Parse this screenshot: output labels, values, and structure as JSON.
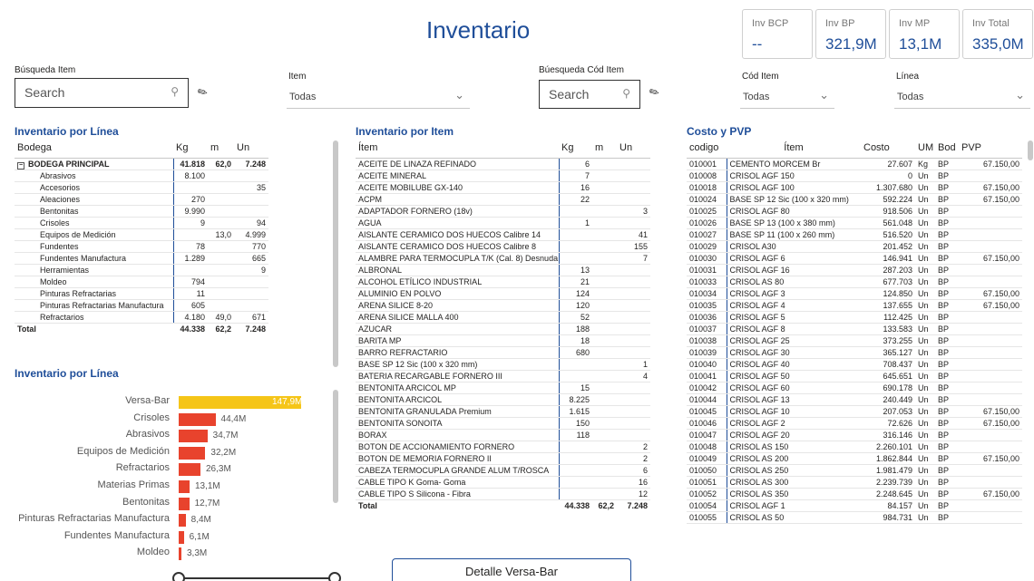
{
  "header": {
    "title": "Inventario"
  },
  "kpis": [
    {
      "label": "Inv BCP",
      "value": "--"
    },
    {
      "label": "Inv BP",
      "value": "321,9M"
    },
    {
      "label": "Inv MP",
      "value": "13,1M"
    },
    {
      "label": "Inv Total",
      "value": "335,0M"
    }
  ],
  "filters": {
    "busqueda_item": {
      "label": "Búsqueda Item",
      "placeholder": "Search"
    },
    "item": {
      "label": "Item",
      "value": "Todas"
    },
    "busqueda_cod_item": {
      "label": "Búesqueda Cód Item",
      "placeholder": "Search"
    },
    "cod_item": {
      "label": "Cód Item",
      "value": "Todas"
    },
    "linea": {
      "label": "Línea",
      "value": "Todas"
    }
  },
  "inv_linea_table": {
    "title": "Inventario por Línea",
    "columns": [
      "Bodega",
      "Kg",
      "m",
      "Un"
    ],
    "parent": {
      "name": "BODEGA PRINCIPAL",
      "kg": "41.818",
      "m": "62,0",
      "un": "7.248"
    },
    "rows": [
      [
        "Abrasivos",
        "8.100",
        "",
        ""
      ],
      [
        "Accesorios",
        "",
        "",
        "35"
      ],
      [
        "Aleaciones",
        "270",
        "",
        ""
      ],
      [
        "Bentonitas",
        "9.990",
        "",
        ""
      ],
      [
        "Crisoles",
        "9",
        "",
        "94"
      ],
      [
        "Equipos de Medición",
        "",
        "13,0",
        "4.999"
      ],
      [
        "Fundentes",
        "78",
        "",
        "770"
      ],
      [
        "Fundentes Manufactura",
        "1.289",
        "",
        "665"
      ],
      [
        "Herramientas",
        "",
        "",
        "9"
      ],
      [
        "Moldeo",
        "794",
        "",
        ""
      ],
      [
        "Pinturas Refractarias",
        "11",
        "",
        ""
      ],
      [
        "Pinturas Refractarias Manufactura",
        "605",
        "",
        ""
      ],
      [
        "Refractarios",
        "4.180",
        "49,0",
        "671"
      ]
    ],
    "total": [
      "Total",
      "44.338",
      "62,2",
      "7.248"
    ]
  },
  "chart_section": {
    "title": "Inventario por Línea"
  },
  "chart_data": {
    "type": "bar",
    "orientation": "horizontal",
    "categories": [
      "Versa-Bar",
      "Crisoles",
      "Abrasivos",
      "Equipos de Medición",
      "Refractarios",
      "Materias Primas",
      "Bentonitas",
      "Pinturas Refractarias Manufactura",
      "Fundentes Manufactura",
      "Moldeo"
    ],
    "values": [
      147.9,
      44.4,
      34.7,
      32.2,
      26.3,
      13.1,
      12.7,
      8.4,
      6.1,
      3.3
    ],
    "labels": [
      "147,9M",
      "44,4M",
      "34,7M",
      "32,2M",
      "26,3M",
      "13,1M",
      "12,7M",
      "8,4M",
      "6,1M",
      "3,3M"
    ],
    "colors": {
      "highlight": "#f5c518",
      "default": "#e8432d"
    },
    "title": "",
    "xlabel": "",
    "ylabel": ""
  },
  "inv_item_table": {
    "title": "Inventario por Item",
    "columns": [
      "Ítem",
      "Kg",
      "m",
      "Un"
    ],
    "rows": [
      [
        "ACEITE DE LINAZA REFINADO",
        "6",
        "",
        ""
      ],
      [
        "ACEITE MINERAL",
        "7",
        "",
        ""
      ],
      [
        "ACEITE MOBILUBE GX-140",
        "16",
        "",
        ""
      ],
      [
        "ACPM",
        "22",
        "",
        ""
      ],
      [
        "ADAPTADOR FORNERO (18v)",
        "",
        "",
        "3"
      ],
      [
        "AGUA",
        "1",
        "",
        ""
      ],
      [
        "AISLANTE CERAMICO DOS HUECOS Calibre 14",
        "",
        "",
        "41"
      ],
      [
        "AISLANTE CERAMICO DOS HUECOS Calibre 8",
        "",
        "",
        "155"
      ],
      [
        "ALAMBRE PARA TERMOCUPLA T/K (Cal. 8) Desnuda",
        "",
        "",
        "7"
      ],
      [
        "ALBRONAL",
        "13",
        "",
        ""
      ],
      [
        "ALCOHOL ETÍLICO INDUSTRIAL",
        "21",
        "",
        ""
      ],
      [
        "ALUMINIO EN POLVO",
        "124",
        "",
        ""
      ],
      [
        "ARENA SILICE 8-20",
        "120",
        "",
        ""
      ],
      [
        "ARENA SILICE MALLA 400",
        "52",
        "",
        ""
      ],
      [
        "AZUCAR",
        "188",
        "",
        ""
      ],
      [
        "BARITA MP",
        "18",
        "",
        ""
      ],
      [
        "BARRO REFRACTARIO",
        "680",
        "",
        ""
      ],
      [
        "BASE SP 12 Sic (100 x 320 mm)",
        "",
        "",
        "1"
      ],
      [
        "BATERIA RECARGABLE FORNERO III",
        "",
        "",
        "4"
      ],
      [
        "BENTONITA ARCICOL MP",
        "15",
        "",
        ""
      ],
      [
        "BENTONITA ARCICOL",
        "8.225",
        "",
        ""
      ],
      [
        "BENTONITA GRANULADA Premium",
        "1.615",
        "",
        ""
      ],
      [
        "BENTONITA SONOITA",
        "150",
        "",
        ""
      ],
      [
        "BORAX",
        "118",
        "",
        ""
      ],
      [
        "BOTON DE ACCIONAMIENTO FORNERO",
        "",
        "",
        "2"
      ],
      [
        "BOTON DE MEMORIA FORNERO II",
        "",
        "",
        "2"
      ],
      [
        "CABEZA TERMOCUPLA GRANDE ALUM T/ROSCA",
        "",
        "",
        "6"
      ],
      [
        "CABLE TIPO K Goma- Goma",
        "",
        "",
        "16"
      ],
      [
        "CABLE TIPO S Silicona - Fibra",
        "",
        "",
        "12"
      ]
    ],
    "total": [
      "Total",
      "44.338",
      "62,2",
      "7.248"
    ]
  },
  "costo_table": {
    "title": "Costo y PVP",
    "columns": [
      "codigo",
      "Ítem",
      "Costo",
      "UM",
      "Bod",
      "PVP"
    ],
    "rows": [
      [
        "010001",
        "CEMENTO MORCEM Br",
        "27.607",
        "Kg",
        "BP",
        "67.150,00"
      ],
      [
        "010008",
        "CRISOL AGF 150",
        "0",
        "Un",
        "BP",
        ""
      ],
      [
        "010018",
        "CRISOL AGF 100",
        "1.307.680",
        "Un",
        "BP",
        "67.150,00"
      ],
      [
        "010024",
        "BASE SP 12 Sic (100 x 320 mm)",
        "592.224",
        "Un",
        "BP",
        "67.150,00"
      ],
      [
        "010025",
        "CRISOL AGF 80",
        "918.506",
        "Un",
        "BP",
        ""
      ],
      [
        "010026",
        "BASE SP 13 (100 x 380 mm)",
        "561.048",
        "Un",
        "BP",
        ""
      ],
      [
        "010027",
        "BASE SP 11 (100 x 260 mm)",
        "516.520",
        "Un",
        "BP",
        ""
      ],
      [
        "010029",
        "CRISOL A30",
        "201.452",
        "Un",
        "BP",
        ""
      ],
      [
        "010030",
        "CRISOL AGF 6",
        "146.941",
        "Un",
        "BP",
        "67.150,00"
      ],
      [
        "010031",
        "CRISOL AGF 16",
        "287.203",
        "Un",
        "BP",
        ""
      ],
      [
        "010033",
        "CRISOL AS 80",
        "677.703",
        "Un",
        "BP",
        ""
      ],
      [
        "010034",
        "CRISOL AGF 3",
        "124.850",
        "Un",
        "BP",
        "67.150,00"
      ],
      [
        "010035",
        "CRISOL AGF 4",
        "137.655",
        "Un",
        "BP",
        "67.150,00"
      ],
      [
        "010036",
        "CRISOL AGF 5",
        "112.425",
        "Un",
        "BP",
        ""
      ],
      [
        "010037",
        "CRISOL AGF 8",
        "133.583",
        "Un",
        "BP",
        ""
      ],
      [
        "010038",
        "CRISOL AGF 25",
        "373.255",
        "Un",
        "BP",
        ""
      ],
      [
        "010039",
        "CRISOL AGF 30",
        "365.127",
        "Un",
        "BP",
        ""
      ],
      [
        "010040",
        "CRISOL AGF 40",
        "708.437",
        "Un",
        "BP",
        ""
      ],
      [
        "010041",
        "CRISOL AGF 50",
        "645.651",
        "Un",
        "BP",
        ""
      ],
      [
        "010042",
        "CRISOL AGF 60",
        "690.178",
        "Un",
        "BP",
        ""
      ],
      [
        "010044",
        "CRISOL AGF 13",
        "240.449",
        "Un",
        "BP",
        ""
      ],
      [
        "010045",
        "CRISOL AGF 10",
        "207.053",
        "Un",
        "BP",
        "67.150,00"
      ],
      [
        "010046",
        "CRISOL AGF 2",
        "72.626",
        "Un",
        "BP",
        "67.150,00"
      ],
      [
        "010047",
        "CRISOL AGF 20",
        "316.146",
        "Un",
        "BP",
        ""
      ],
      [
        "010048",
        "CRISOL AS 150",
        "2.260.101",
        "Un",
        "BP",
        ""
      ],
      [
        "010049",
        "CRISOL AS 200",
        "1.862.844",
        "Un",
        "BP",
        "67.150,00"
      ],
      [
        "010050",
        "CRISOL AS 250",
        "1.981.479",
        "Un",
        "BP",
        ""
      ],
      [
        "010051",
        "CRISOL AS 300",
        "2.239.739",
        "Un",
        "BP",
        ""
      ],
      [
        "010052",
        "CRISOL AS 350",
        "2.248.645",
        "Un",
        "BP",
        "67.150,00"
      ],
      [
        "010054",
        "CRISOL AGF 1",
        "84.157",
        "Un",
        "BP",
        ""
      ],
      [
        "010055",
        "CRISOL AS 50",
        "984.731",
        "Un",
        "BP",
        ""
      ]
    ]
  },
  "buttons": {
    "detalle": "Detalle Versa-Bar"
  }
}
